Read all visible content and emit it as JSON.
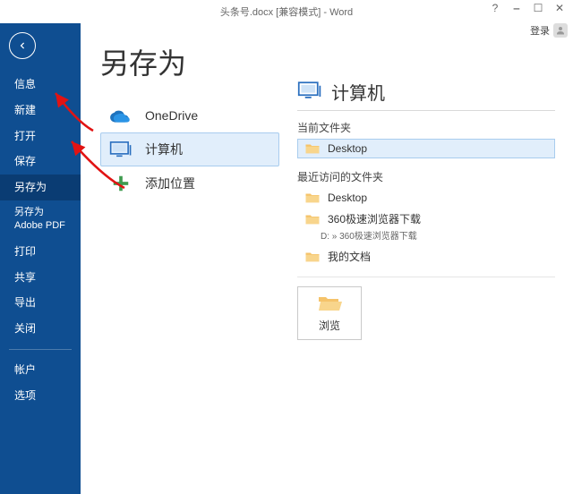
{
  "window": {
    "title": "头条号.docx [兼容模式] - Word",
    "login_label": "登录"
  },
  "sidebar": {
    "items": [
      {
        "label": "信息"
      },
      {
        "label": "新建"
      },
      {
        "label": "打开"
      },
      {
        "label": "保存"
      },
      {
        "label": "另存为"
      },
      {
        "label": "另存为 Adobe PDF"
      },
      {
        "label": "打印"
      },
      {
        "label": "共享"
      },
      {
        "label": "导出"
      },
      {
        "label": "关闭"
      }
    ],
    "items2": [
      {
        "label": "帐户"
      },
      {
        "label": "选项"
      }
    ]
  },
  "main": {
    "page_title": "另存为",
    "locations": {
      "onedrive": "OneDrive",
      "computer": "计算机",
      "add_place": "添加位置"
    },
    "right": {
      "heading": "计算机",
      "current_folder_label": "当前文件夹",
      "current_folder": "Desktop",
      "recent_label": "最近访问的文件夹",
      "recent": [
        {
          "name": "Desktop",
          "sub": ""
        },
        {
          "name": "360极速浏览器下载",
          "sub": "D: » 360极速浏览器下载"
        },
        {
          "name": "我的文档",
          "sub": ""
        }
      ],
      "browse_label": "浏览"
    }
  },
  "colors": {
    "brand": "#0f4e91",
    "select_bg": "#e1eefb",
    "select_border": "#a8ccee",
    "arrow": "#e11313"
  }
}
